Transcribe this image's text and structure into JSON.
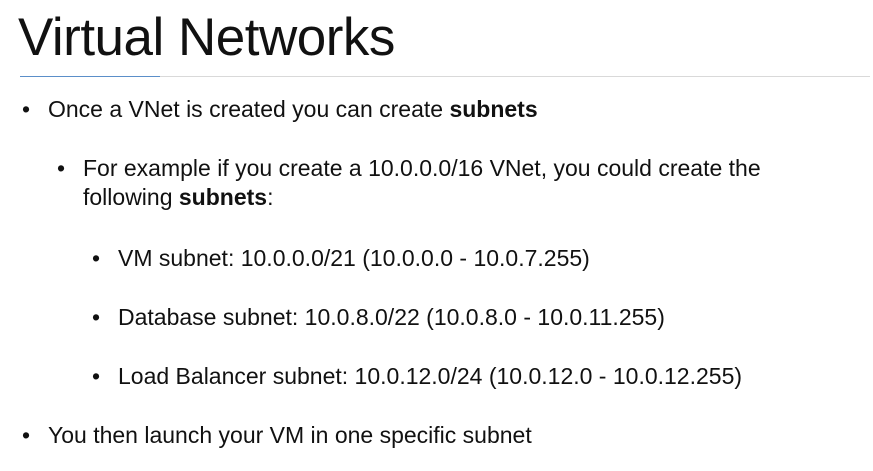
{
  "slide": {
    "title": "Virtual Networks",
    "bullet_glyph": "•",
    "bullets": [
      {
        "text_before": "Once a VNet is created you can create ",
        "bold": "subnets",
        "text_after": ""
      },
      {
        "text_before": "For example if you create a 10.0.0.0/16 VNet, you could create the following ",
        "bold": "subnets",
        "text_after": ":"
      },
      {
        "text": "VM subnet: 10.0.0.0/21 (10.0.0.0 - 10.0.7.255)"
      },
      {
        "text": "Database subnet: 10.0.8.0/22 (10.0.8.0 - 10.0.11.255)"
      },
      {
        "text": "Load Balancer subnet: 10.0.12.0/24 (10.0.12.0 - 10.0.12.255)"
      },
      {
        "text": "You then launch your VM in one specific subnet"
      }
    ]
  },
  "colors": {
    "text": "#111111",
    "rule": "#d9d9d9",
    "accent": "#5b8fc9",
    "background": "#ffffff"
  }
}
